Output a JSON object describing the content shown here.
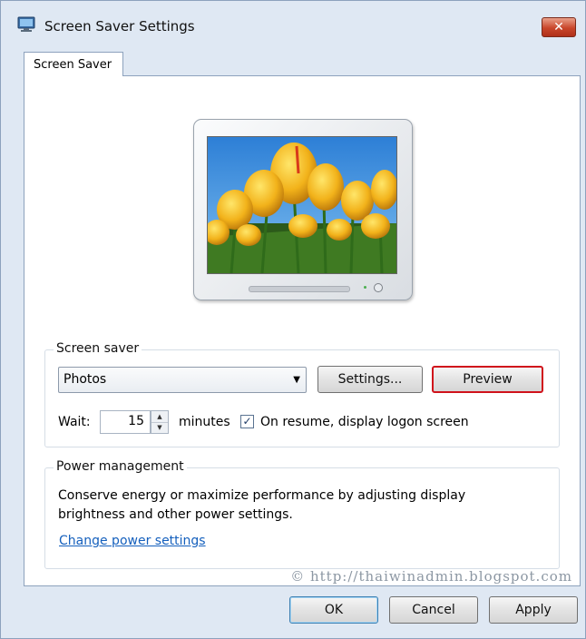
{
  "window": {
    "title": "Screen Saver Settings",
    "icon": "monitor-settings-icon",
    "close_glyph": "✕"
  },
  "tabs": [
    {
      "label": "Screen Saver",
      "selected": true
    }
  ],
  "preview_monitor": {
    "image": "yellow-tulips-photo"
  },
  "screen_saver": {
    "group_label": "Screen saver",
    "selected": "Photos",
    "settings_label": "Settings...",
    "preview_label": "Preview",
    "wait_label": "Wait:",
    "wait_value": "15",
    "minutes_label": "minutes",
    "resume_checked": true,
    "resume_label": "On resume, display logon screen"
  },
  "power_management": {
    "group_label": "Power management",
    "description": "Conserve energy or maximize performance by adjusting display brightness and other power settings.",
    "link_label": "Change power settings"
  },
  "watermark": "© http://thaiwinadmin.blogspot.com",
  "buttons": {
    "ok": "OK",
    "cancel": "Cancel",
    "apply": "Apply"
  },
  "colors": {
    "window_frame": "#dfe8f3",
    "highlight_red": "#d0121b",
    "link_blue": "#1560bd"
  }
}
